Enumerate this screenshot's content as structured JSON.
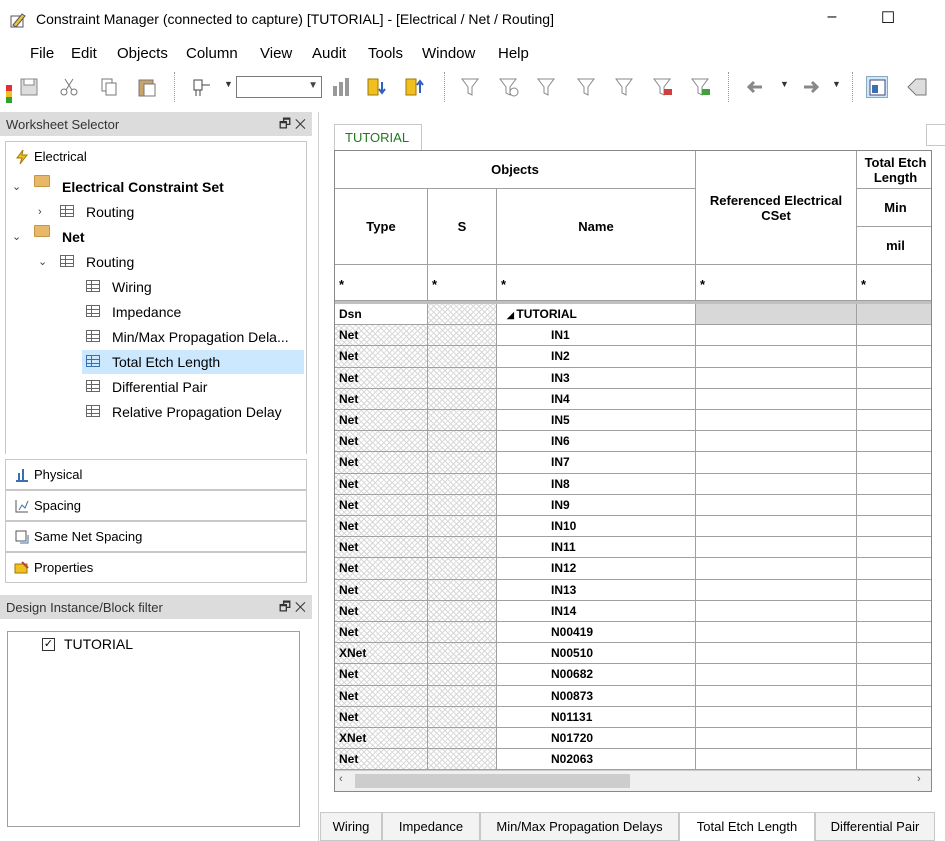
{
  "window": {
    "title": "Constraint Manager (connected to capture) [TUTORIAL] - [Electrical / Net / Routing]",
    "minimize": "–",
    "maximize": "☐"
  },
  "menu": [
    "File",
    "Edit",
    "Objects",
    "Column",
    "View",
    "Audit",
    "Tools",
    "Window",
    "Help"
  ],
  "worksheet_selector": {
    "title": "Worksheet Selector",
    "tabs": [
      "Electrical",
      "Physical",
      "Spacing",
      "Same Net Spacing",
      "Properties"
    ],
    "tree": {
      "ecs_label": "Electrical Constraint Set",
      "ecs_routing": "Routing",
      "net_label": "Net",
      "net_routing": "Routing",
      "worksheets": [
        "Wiring",
        "Impedance",
        "Min/Max Propagation Dela...",
        "Total Etch Length",
        "Differential Pair",
        "Relative Propagation Delay"
      ]
    }
  },
  "design_filter": {
    "title": "Design Instance/Block filter",
    "item": "TUTORIAL"
  },
  "doc_tab": "TUTORIAL",
  "grid": {
    "headers": {
      "objects": "Objects",
      "type": "Type",
      "s": "S",
      "name": "Name",
      "ref_cset": "Referenced Electrical CSet",
      "total_etch": "Total Etch Length",
      "min": "Min",
      "unit": "mil",
      "filter": "*"
    },
    "rows": [
      {
        "type": "Dsn",
        "name": "TUTORIAL"
      },
      {
        "type": "Net",
        "name": "IN1"
      },
      {
        "type": "Net",
        "name": "IN2"
      },
      {
        "type": "Net",
        "name": "IN3"
      },
      {
        "type": "Net",
        "name": "IN4"
      },
      {
        "type": "Net",
        "name": "IN5"
      },
      {
        "type": "Net",
        "name": "IN6"
      },
      {
        "type": "Net",
        "name": "IN7"
      },
      {
        "type": "Net",
        "name": "IN8"
      },
      {
        "type": "Net",
        "name": "IN9"
      },
      {
        "type": "Net",
        "name": "IN10"
      },
      {
        "type": "Net",
        "name": "IN11"
      },
      {
        "type": "Net",
        "name": "IN12"
      },
      {
        "type": "Net",
        "name": "IN13"
      },
      {
        "type": "Net",
        "name": "IN14"
      },
      {
        "type": "Net",
        "name": "N00419"
      },
      {
        "type": "XNet",
        "name": "N00510"
      },
      {
        "type": "Net",
        "name": "N00682"
      },
      {
        "type": "Net",
        "name": "N00873"
      },
      {
        "type": "Net",
        "name": "N01131"
      },
      {
        "type": "XNet",
        "name": "N01720"
      },
      {
        "type": "Net",
        "name": "N02063"
      }
    ]
  },
  "bottom_tabs": [
    "Wiring",
    "Impedance",
    "Min/Max Propagation Delays",
    "Total Etch Length",
    "Differential Pair"
  ],
  "active_bottom_tab": "Total Etch Length"
}
